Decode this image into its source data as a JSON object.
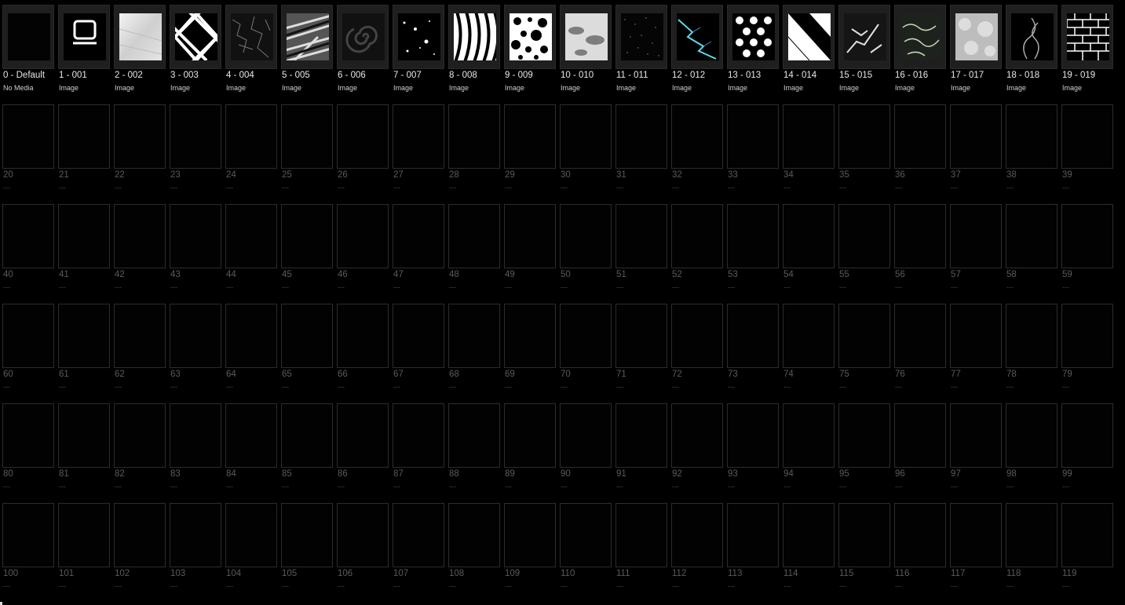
{
  "media_bank": {
    "used_slots": [
      {
        "label": "0 - Default",
        "type": "No Media",
        "icon": "empty-media-icon"
      },
      {
        "label": "1 - 001",
        "type": "Image",
        "icon": "monitor-icon"
      },
      {
        "label": "2 - 002",
        "type": "Image",
        "icon": "brushed-metal-texture"
      },
      {
        "label": "3 - 003",
        "type": "Image",
        "icon": "diamond-lattice-pattern"
      },
      {
        "label": "4 - 004",
        "type": "Image",
        "icon": "cracked-texture"
      },
      {
        "label": "5 - 005",
        "type": "Image",
        "icon": "streak-texture"
      },
      {
        "label": "6 - 006",
        "type": "Image",
        "icon": "spiral-pattern"
      },
      {
        "label": "7 - 007",
        "type": "Image",
        "icon": "speckle-texture"
      },
      {
        "label": "8 - 008",
        "type": "Image",
        "icon": "zebra-stripes-pattern"
      },
      {
        "label": "9 - 009",
        "type": "Image",
        "icon": "bubbles-pattern"
      },
      {
        "label": "10 - 010",
        "type": "Image",
        "icon": "clouds-texture"
      },
      {
        "label": "11 - 011",
        "type": "Image",
        "icon": "starfield-texture"
      },
      {
        "label": "12 - 012",
        "type": "Image",
        "icon": "lightning-image"
      },
      {
        "label": "13 - 013",
        "type": "Image",
        "icon": "dots-pattern"
      },
      {
        "label": "14 - 014",
        "type": "Image",
        "icon": "diagonal-split-pattern"
      },
      {
        "label": "15 - 015",
        "type": "Image",
        "icon": "marble-texture"
      },
      {
        "label": "16 - 016",
        "type": "Image",
        "icon": "water-caustics-texture"
      },
      {
        "label": "17 - 017",
        "type": "Image",
        "icon": "bokeh-texture"
      },
      {
        "label": "18 - 018",
        "type": "Image",
        "icon": "smoke-image"
      },
      {
        "label": "19 - 019",
        "type": "Image",
        "icon": "brick-wall-pattern"
      }
    ],
    "empty_slots": [
      {
        "label": "20",
        "type": "---"
      },
      {
        "label": "21",
        "type": "---"
      },
      {
        "label": "22",
        "type": "---"
      },
      {
        "label": "23",
        "type": "---"
      },
      {
        "label": "24",
        "type": "---"
      },
      {
        "label": "25",
        "type": "---"
      },
      {
        "label": "26",
        "type": "---"
      },
      {
        "label": "27",
        "type": "---"
      },
      {
        "label": "28",
        "type": "---"
      },
      {
        "label": "29",
        "type": "---"
      },
      {
        "label": "30",
        "type": "---"
      },
      {
        "label": "31",
        "type": "---"
      },
      {
        "label": "32",
        "type": "---"
      },
      {
        "label": "33",
        "type": "---"
      },
      {
        "label": "34",
        "type": "---"
      },
      {
        "label": "35",
        "type": "---"
      },
      {
        "label": "36",
        "type": "---"
      },
      {
        "label": "37",
        "type": "---"
      },
      {
        "label": "38",
        "type": "---"
      },
      {
        "label": "39",
        "type": "---"
      },
      {
        "label": "40",
        "type": "---"
      },
      {
        "label": "41",
        "type": "---"
      },
      {
        "label": "42",
        "type": "---"
      },
      {
        "label": "43",
        "type": "---"
      },
      {
        "label": "44",
        "type": "---"
      },
      {
        "label": "45",
        "type": "---"
      },
      {
        "label": "46",
        "type": "---"
      },
      {
        "label": "47",
        "type": "---"
      },
      {
        "label": "48",
        "type": "---"
      },
      {
        "label": "49",
        "type": "---"
      },
      {
        "label": "50",
        "type": "---"
      },
      {
        "label": "51",
        "type": "---"
      },
      {
        "label": "52",
        "type": "---"
      },
      {
        "label": "53",
        "type": "---"
      },
      {
        "label": "54",
        "type": "---"
      },
      {
        "label": "55",
        "type": "---"
      },
      {
        "label": "56",
        "type": "---"
      },
      {
        "label": "57",
        "type": "---"
      },
      {
        "label": "58",
        "type": "---"
      },
      {
        "label": "59",
        "type": "---"
      },
      {
        "label": "60",
        "type": "---"
      },
      {
        "label": "61",
        "type": "---"
      },
      {
        "label": "62",
        "type": "---"
      },
      {
        "label": "63",
        "type": "---"
      },
      {
        "label": "64",
        "type": "---"
      },
      {
        "label": "65",
        "type": "---"
      },
      {
        "label": "66",
        "type": "---"
      },
      {
        "label": "67",
        "type": "---"
      },
      {
        "label": "68",
        "type": "---"
      },
      {
        "label": "69",
        "type": "---"
      },
      {
        "label": "70",
        "type": "---"
      },
      {
        "label": "71",
        "type": "---"
      },
      {
        "label": "72",
        "type": "---"
      },
      {
        "label": "73",
        "type": "---"
      },
      {
        "label": "74",
        "type": "---"
      },
      {
        "label": "75",
        "type": "---"
      },
      {
        "label": "76",
        "type": "---"
      },
      {
        "label": "77",
        "type": "---"
      },
      {
        "label": "78",
        "type": "---"
      },
      {
        "label": "79",
        "type": "---"
      },
      {
        "label": "80",
        "type": "---"
      },
      {
        "label": "81",
        "type": "---"
      },
      {
        "label": "82",
        "type": "---"
      },
      {
        "label": "83",
        "type": "---"
      },
      {
        "label": "84",
        "type": "---"
      },
      {
        "label": "85",
        "type": "---"
      },
      {
        "label": "86",
        "type": "---"
      },
      {
        "label": "87",
        "type": "---"
      },
      {
        "label": "88",
        "type": "---"
      },
      {
        "label": "89",
        "type": "---"
      },
      {
        "label": "90",
        "type": "---"
      },
      {
        "label": "91",
        "type": "---"
      },
      {
        "label": "92",
        "type": "---"
      },
      {
        "label": "93",
        "type": "---"
      },
      {
        "label": "94",
        "type": "---"
      },
      {
        "label": "95",
        "type": "---"
      },
      {
        "label": "96",
        "type": "---"
      },
      {
        "label": "97",
        "type": "---"
      },
      {
        "label": "98",
        "type": "---"
      },
      {
        "label": "99",
        "type": "---"
      },
      {
        "label": "100",
        "type": "---"
      },
      {
        "label": "101",
        "type": "---"
      },
      {
        "label": "102",
        "type": "---"
      },
      {
        "label": "103",
        "type": "---"
      },
      {
        "label": "104",
        "type": "---"
      },
      {
        "label": "105",
        "type": "---"
      },
      {
        "label": "106",
        "type": "---"
      },
      {
        "label": "107",
        "type": "---"
      },
      {
        "label": "108",
        "type": "---"
      },
      {
        "label": "109",
        "type": "---"
      },
      {
        "label": "110",
        "type": "---"
      },
      {
        "label": "111",
        "type": "---"
      },
      {
        "label": "112",
        "type": "---"
      },
      {
        "label": "113",
        "type": "---"
      },
      {
        "label": "114",
        "type": "---"
      },
      {
        "label": "115",
        "type": "---"
      },
      {
        "label": "116",
        "type": "---"
      },
      {
        "label": "117",
        "type": "---"
      },
      {
        "label": "118",
        "type": "---"
      },
      {
        "label": "119",
        "type": "---"
      }
    ]
  },
  "colors": {
    "background": "#000000",
    "used_tile": "#1f1f1f",
    "empty_border": "#2c2c2c",
    "used_text": "#e8e8e8",
    "empty_text": "#5a5a5a",
    "lightning_accent": "#5fd8e8"
  }
}
